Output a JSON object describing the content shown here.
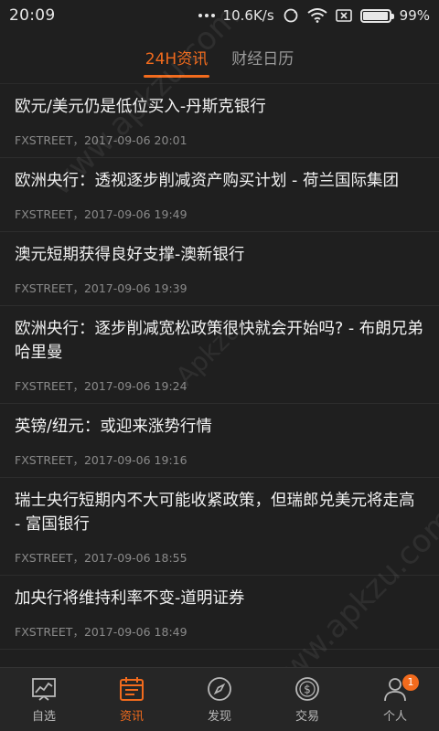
{
  "status_bar": {
    "time": "20:09",
    "network_speed": "10.6K/s",
    "battery_percent": "99%",
    "battery_level": 0.99
  },
  "tabs": [
    {
      "label": "24H资讯",
      "active": true
    },
    {
      "label": "财经日历",
      "active": false
    }
  ],
  "news": [
    {
      "title": "欧元/美元仍是低位买入-丹斯克银行",
      "meta": "FXSTREET，2017-09-06 20:01"
    },
    {
      "title": "欧洲央行：透视逐步削减资产购买计划 - 荷兰国际集团",
      "meta": "FXSTREET，2017-09-06 19:49"
    },
    {
      "title": "澳元短期获得良好支撑-澳新银行",
      "meta": "FXSTREET，2017-09-06 19:39"
    },
    {
      "title": "欧洲央行：逐步削减宽松政策很快就会开始吗? - 布朗兄弟哈里曼",
      "meta": "FXSTREET，2017-09-06 19:24"
    },
    {
      "title": "英镑/纽元：或迎来涨势行情",
      "meta": "FXSTREET，2017-09-06 19:16"
    },
    {
      "title": "瑞士央行短期内不大可能收紧政策，但瑞郎兑美元将走高 - 富国银行",
      "meta": "FXSTREET，2017-09-06 18:55"
    },
    {
      "title": "加央行将维持利率不变-道明证券",
      "meta": "FXSTREET，2017-09-06 18:49"
    }
  ],
  "bottom_nav": [
    {
      "label": "自选",
      "icon": "chart-icon",
      "active": false
    },
    {
      "label": "资讯",
      "icon": "calendar-icon",
      "active": true
    },
    {
      "label": "发现",
      "icon": "compass-icon",
      "active": false
    },
    {
      "label": "交易",
      "icon": "dollar-icon",
      "active": false
    },
    {
      "label": "个人",
      "icon": "person-icon",
      "active": false,
      "badge": "1"
    }
  ],
  "watermark": {
    "text_1": "www.apkzu.com",
    "text_2": "Apkzu",
    "text_3": "www.apkzu.com"
  },
  "colors": {
    "accent": "#f26b1d",
    "background": "#1f1f1f",
    "nav_background": "#262626"
  }
}
